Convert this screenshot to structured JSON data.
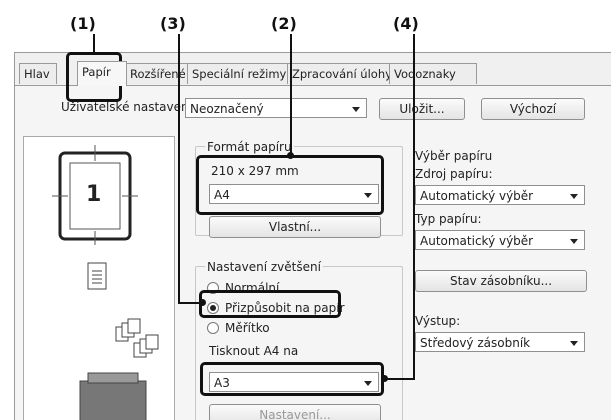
{
  "callouts": [
    "(1)",
    "(3)",
    "(2)",
    "(4)"
  ],
  "tabs": [
    "Hlav",
    "Papír",
    "Rozšířené",
    "Speciální režimy",
    "Zpracování úlohy",
    "Vodoznaky"
  ],
  "user_settings": {
    "label": "Uživatelské nastavení:",
    "value": "Neoznačený",
    "save_button": "Uložit...",
    "default_button": "Výchozí"
  },
  "paper_size": {
    "group_label": "Formát papíru",
    "dimensions": "210 x 297 mm",
    "value": "A4",
    "custom_button": "Vlastní..."
  },
  "zoom": {
    "group_label": "Nastavení zvětšení",
    "options": [
      "Normální",
      "Přizpůsobit na papír",
      "Měřítko"
    ],
    "selected": "Přizpůsobit na papír",
    "print_on_label": "Tisknout A4 na",
    "print_on_value": "A3",
    "settings_button": "Nastavení..."
  },
  "paper_selection": {
    "group_label": "Výběr papíru",
    "source_label": "Zdroj papíru:",
    "source_value": "Automatický výběr",
    "type_label": "Typ papíru:",
    "type_value": "Automatický výběr",
    "tray_status_button": "Stav zásobníku..."
  },
  "output": {
    "label": "Výstup:",
    "value": "Středový zásobník"
  },
  "preview": {
    "page_number": "1"
  }
}
